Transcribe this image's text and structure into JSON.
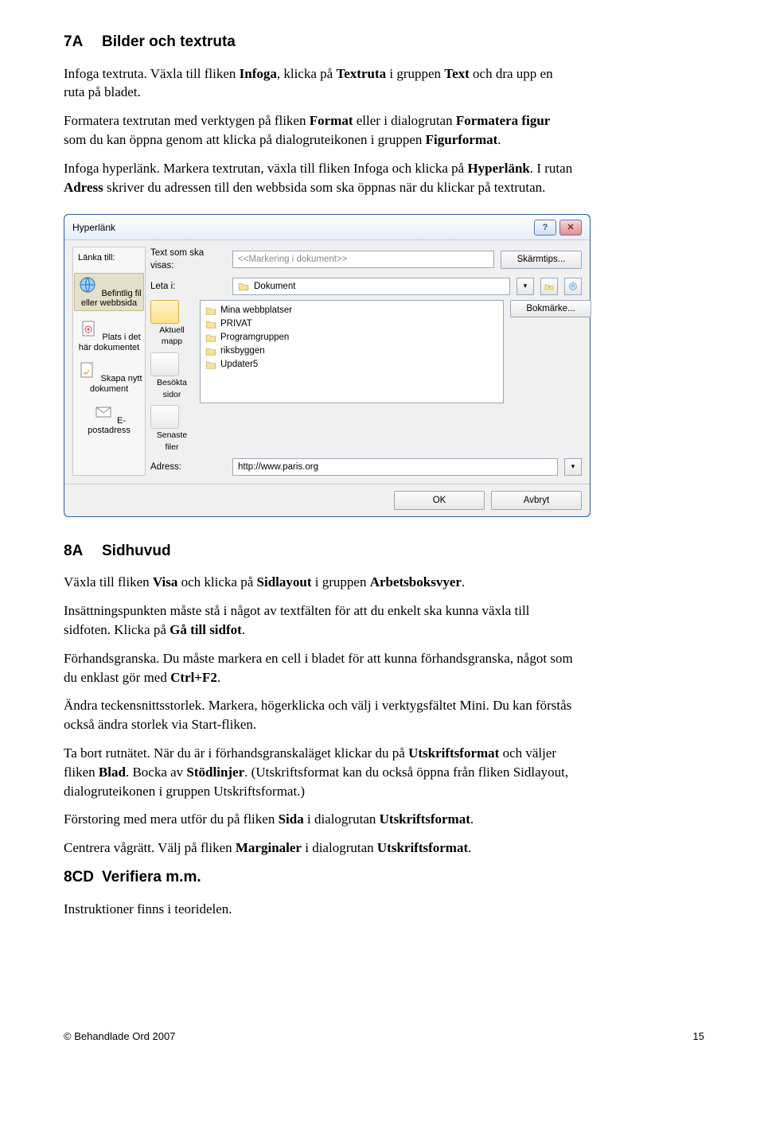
{
  "section7": {
    "idx": "7A",
    "title": "Bilder och textruta",
    "p1a": "Infoga textruta. Växla till fliken ",
    "p1b": "Infoga",
    "p1c": ", klicka på ",
    "p1d": "Textruta",
    "p1e": " i gruppen ",
    "p1f": "Text",
    "p1g": " och dra upp en ruta på bladet.",
    "p2a": "Formatera textrutan med verktygen på fliken ",
    "p2b": "Format",
    "p2c": " eller i dialogrutan ",
    "p2d": "Formatera figur",
    "p2e": " som du kan öppna genom att klicka på dialogruteikonen i gruppen ",
    "p2f": "Figurformat",
    "p2g": ".",
    "p3a": "Infoga hyperlänk. Markera textrutan, växla till fliken Infoga och klicka på ",
    "p3b": "Hyperlänk",
    "p3c": ". I rutan ",
    "p3d": "Adress",
    "p3e": " skriver du adressen till den webbsida som ska öppnas när du klickar på textrutan."
  },
  "dialog": {
    "title": "Hyperlänk",
    "linkToLabel": "Länka till:",
    "linkItems": [
      "Befintlig fil eller webbsida",
      "Plats i det här dokumentet",
      "Skapa nytt dokument",
      "E-postadress"
    ],
    "textLabel": "Text som ska visas:",
    "textValue": "<<Markering i dokument>>",
    "screenTip": "Skärmtips...",
    "lookInLabel": "Leta i:",
    "lookInValue": "Dokument",
    "bookmark": "Bokmärke...",
    "navItems": [
      "Aktuell mapp",
      "Besökta sidor",
      "Senaste filer"
    ],
    "files": [
      "Mina webbplatser",
      "PRIVAT",
      "Programgruppen",
      "riksbyggen",
      "Updater5"
    ],
    "addressLabel": "Adress:",
    "addressValue": "http://www.paris.org",
    "ok": "OK",
    "cancel": "Avbryt"
  },
  "section8": {
    "idx": "8A",
    "title": "Sidhuvud",
    "p1a": "Växla till fliken ",
    "p1b": "Visa",
    "p1c": " och klicka på ",
    "p1d": "Sidlayout",
    "p1e": " i gruppen ",
    "p1f": "Arbetsboksvyer",
    "p1g": ".",
    "p2a": "Insättningspunkten måste stå i något av textfälten för att du enkelt ska kunna växla till sidfoten. Klicka på ",
    "p2b": "Gå till sidfot",
    "p2c": ".",
    "p3a": "Förhandsgranska. Du måste markera en cell i bladet för att kunna förhandsgranska, något som du enklast gör med ",
    "p3b": "Ctrl+F2",
    "p3c": ".",
    "p4a": "Ändra teckensnittsstorlek. Markera, högerklicka och välj i verktygsfältet Mini. Du kan förstås också ändra storlek via Start-fliken.",
    "p5a": "Ta bort rutnätet. När du är i förhandsgranskaläget klickar du på ",
    "p5b": "Utskriftsformat",
    "p5c": " och väljer fliken ",
    "p5d": "Blad",
    "p5e": ". Bocka av ",
    "p5f": "Stödlinjer",
    "p5g": ". (Utskriftsformat kan du också öppna från fliken Sidlayout, dialogruteikonen i gruppen Utskriftsformat.)",
    "p6a": "Förstoring med mera utför du på fliken ",
    "p6b": "Sida",
    "p6c": " i dialogrutan ",
    "p6d": "Utskriftsformat",
    "p6e": ".",
    "p7a": "Centrera vågrätt. Välj på fliken ",
    "p7b": "Marginaler",
    "p7c": " i dialogrutan ",
    "p7d": "Utskriftsformat",
    "p7e": "."
  },
  "section8cd": {
    "idx": "8CD",
    "title": "Verifiera m.m.",
    "p1": "Instruktioner finns i teoridelen."
  },
  "footer": {
    "left": "© Behandlade Ord 2007",
    "right": "15"
  }
}
